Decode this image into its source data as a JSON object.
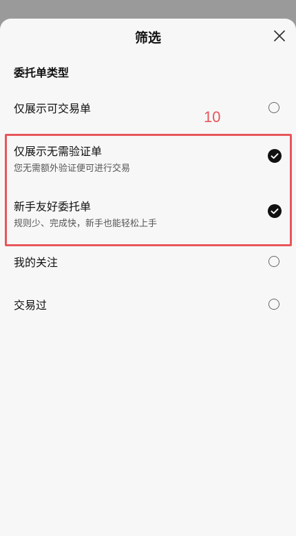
{
  "sheet": {
    "title": "筛选",
    "close_icon": "close-icon"
  },
  "section": {
    "title": "委托单类型"
  },
  "options": [
    {
      "label": "仅展示可交易单",
      "sublabel": "",
      "selected": false
    },
    {
      "label": "仅展示无需验证单",
      "sublabel": "您无需额外验证便可进行交易",
      "selected": true
    },
    {
      "label": "新手友好委托单",
      "sublabel": "规则少、完成快，新手也能轻松上手",
      "selected": true
    },
    {
      "label": "我的关注",
      "sublabel": "",
      "selected": false
    },
    {
      "label": "交易过",
      "sublabel": "",
      "selected": false
    }
  ],
  "annotation": {
    "number": "10",
    "color": "#e8555a"
  }
}
